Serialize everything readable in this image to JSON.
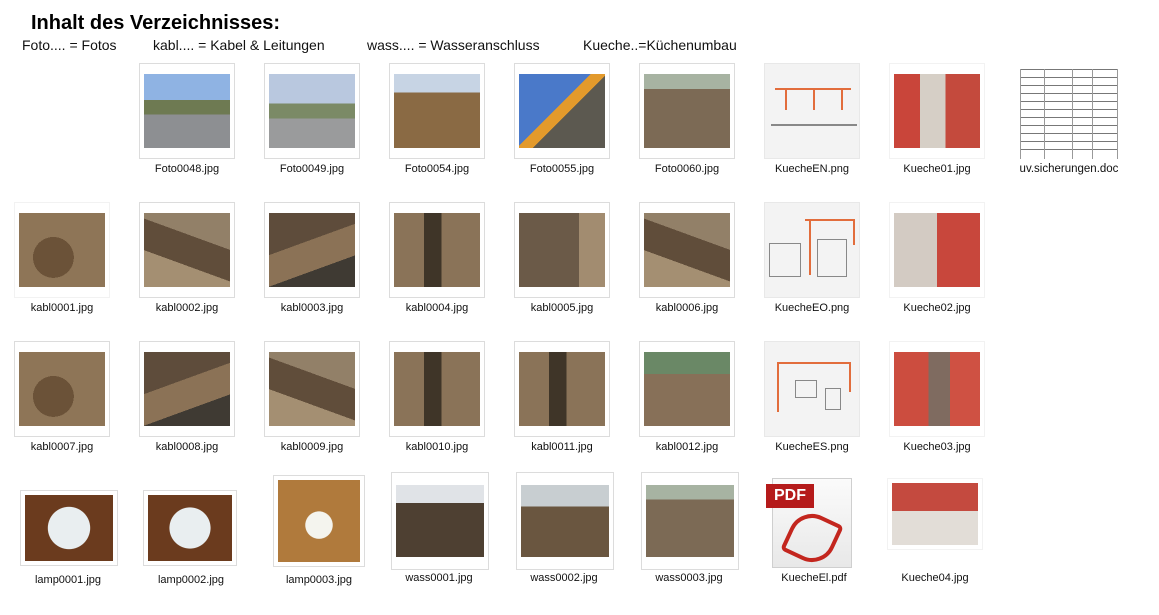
{
  "heading": "Inhalt des Verzeichnisses:",
  "legend": [
    "Foto.... = Fotos",
    "kabl.... = Kabel & Leitungen",
    "wass.... = Wasseranschluss",
    "Kueche..=Küchenumbau"
  ],
  "files": [
    {
      "name": "Foto0048.jpg",
      "icon": "photo-thumbnail"
    },
    {
      "name": "Foto0049.jpg",
      "icon": "photo-thumbnail"
    },
    {
      "name": "Foto0054.jpg",
      "icon": "photo-thumbnail"
    },
    {
      "name": "Foto0055.jpg",
      "icon": "photo-thumbnail"
    },
    {
      "name": "Foto0060.jpg",
      "icon": "photo-thumbnail"
    },
    {
      "name": "KuecheEN.png",
      "icon": "plan-thumbnail"
    },
    {
      "name": "Kueche01.jpg",
      "icon": "photo-thumbnail"
    },
    {
      "name": "uv.sicherungen.doc",
      "icon": "document-thumbnail"
    },
    {
      "name": "kabl0001.jpg",
      "icon": "photo-thumbnail"
    },
    {
      "name": "kabl0002.jpg",
      "icon": "photo-thumbnail"
    },
    {
      "name": "kabl0003.jpg",
      "icon": "photo-thumbnail"
    },
    {
      "name": "kabl0004.jpg",
      "icon": "photo-thumbnail"
    },
    {
      "name": "kabl0005.jpg",
      "icon": "photo-thumbnail"
    },
    {
      "name": "kabl0006.jpg",
      "icon": "photo-thumbnail"
    },
    {
      "name": "KuecheEO.png",
      "icon": "plan-thumbnail"
    },
    {
      "name": "Kueche02.jpg",
      "icon": "photo-thumbnail"
    },
    {
      "name": "kabl0007.jpg",
      "icon": "photo-thumbnail"
    },
    {
      "name": "kabl0008.jpg",
      "icon": "photo-thumbnail"
    },
    {
      "name": "kabl0009.jpg",
      "icon": "photo-thumbnail"
    },
    {
      "name": "kabl0010.jpg",
      "icon": "photo-thumbnail"
    },
    {
      "name": "kabl0011.jpg",
      "icon": "photo-thumbnail"
    },
    {
      "name": "kabl0012.jpg",
      "icon": "photo-thumbnail"
    },
    {
      "name": "KuecheES.png",
      "icon": "plan-thumbnail"
    },
    {
      "name": "Kueche03.jpg",
      "icon": "photo-thumbnail"
    },
    {
      "name": "lamp0001.jpg",
      "icon": "photo-thumbnail"
    },
    {
      "name": "lamp0002.jpg",
      "icon": "photo-thumbnail"
    },
    {
      "name": "lamp0003.jpg",
      "icon": "photo-thumbnail"
    },
    {
      "name": "wass0001.jpg",
      "icon": "photo-thumbnail"
    },
    {
      "name": "wass0002.jpg",
      "icon": "photo-thumbnail"
    },
    {
      "name": "wass0003.jpg",
      "icon": "photo-thumbnail"
    },
    {
      "name": "KuecheEl.pdf",
      "icon": "pdf-icon"
    },
    {
      "name": "Kueche04.jpg",
      "icon": "photo-thumbnail"
    }
  ]
}
